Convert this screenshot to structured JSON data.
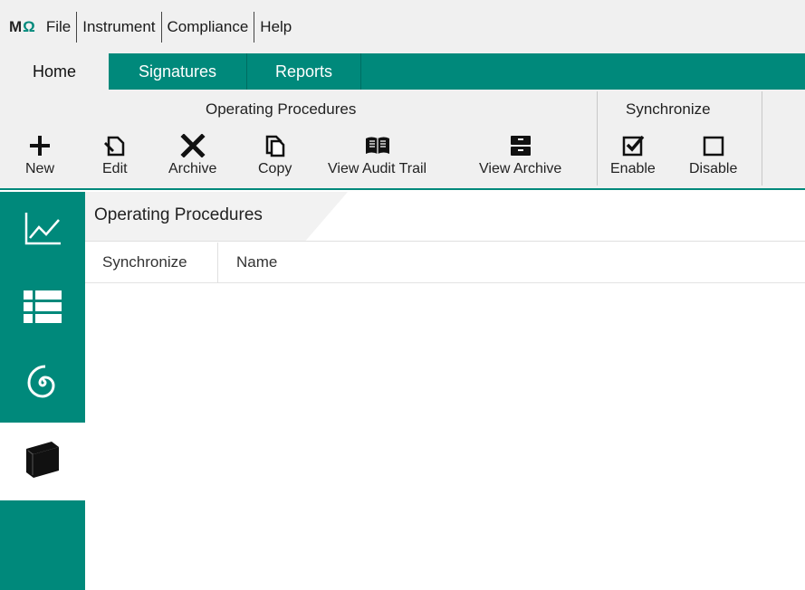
{
  "app": {
    "logo_text": "M",
    "logo_accent": "Ω"
  },
  "menu": {
    "items": [
      {
        "label": "File"
      },
      {
        "label": "Instrument"
      },
      {
        "label": "Compliance"
      },
      {
        "label": "Help"
      }
    ]
  },
  "tabs": [
    {
      "label": "Home",
      "active": true
    },
    {
      "label": "Signatures",
      "active": false
    },
    {
      "label": "Reports",
      "active": false
    }
  ],
  "ribbon": {
    "groups": [
      {
        "title": "Operating Procedures",
        "buttons": [
          {
            "label": "New",
            "icon": "plus-icon"
          },
          {
            "label": "Edit",
            "icon": "edit-icon"
          },
          {
            "label": "Archive",
            "icon": "archive-x-icon"
          },
          {
            "label": "Copy",
            "icon": "copy-icon"
          },
          {
            "label": "View Audit Trail",
            "icon": "open-book-icon"
          },
          {
            "label": "View Archive",
            "icon": "file-box-icon"
          }
        ]
      },
      {
        "title": "Synchronize",
        "buttons": [
          {
            "label": "Enable",
            "icon": "checked-box-icon"
          },
          {
            "label": "Disable",
            "icon": "empty-box-icon"
          }
        ]
      }
    ]
  },
  "rail": {
    "items": [
      {
        "icon": "line-chart-icon",
        "active": false
      },
      {
        "icon": "list-icon",
        "active": false
      },
      {
        "icon": "spiral-icon",
        "active": false
      },
      {
        "icon": "book-icon",
        "active": true
      },
      {
        "icon": "",
        "active": false
      }
    ]
  },
  "panel": {
    "title": "Operating Procedures",
    "columns": [
      "Synchronize",
      "Name"
    ],
    "rows": []
  },
  "colors": {
    "accent": "#00897b",
    "chrome": "#f0f0f0"
  }
}
